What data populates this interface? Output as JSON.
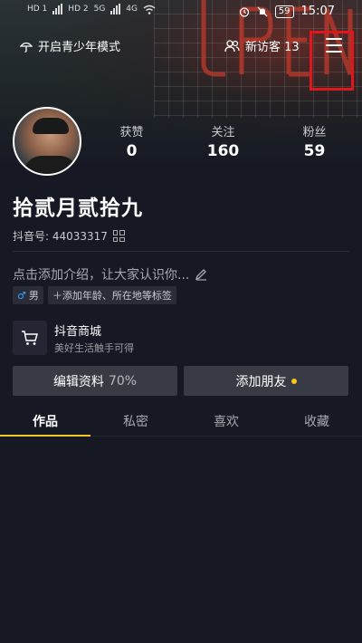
{
  "status_bar": {
    "left_badges": [
      "HD 1",
      "HD 2",
      "5G",
      "4G"
    ],
    "battery": "59",
    "time": "15:07"
  },
  "top_bar": {
    "teen_mode_label": "开启青少年模式",
    "visitors_label": "新访客 13",
    "menu_icon": "hamburger-menu-icon"
  },
  "profile": {
    "stats": [
      {
        "label": "获赞",
        "value": "0"
      },
      {
        "label": "关注",
        "value": "160"
      },
      {
        "label": "粉丝",
        "value": "59"
      }
    ],
    "nickname": "拾贰月贰拾九",
    "douyin_id": "抖音号: 44033317",
    "bio_placeholder": "点击添加介绍，让大家认识你...",
    "gender_tag": "男",
    "add_tags_label": "＋添加年龄、所在地等标签"
  },
  "shop": {
    "title": "抖音商城",
    "subtitle": "美好生活触手可得"
  },
  "actions": {
    "edit_label": "编辑资料",
    "edit_progress": "70%",
    "add_friends_label": "添加朋友"
  },
  "tabs": [
    "作品",
    "私密",
    "喜欢",
    "收藏"
  ],
  "colors": {
    "background": "#161823",
    "accent": "#f5c61f",
    "highlight_box": "#e0161c"
  }
}
